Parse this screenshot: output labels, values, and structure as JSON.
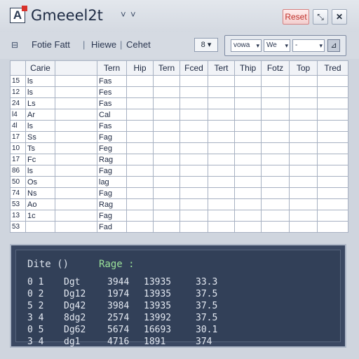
{
  "window": {
    "app_icon_glyph": "A",
    "title": "Gmeeel2t",
    "title_arrows": [
      "˅",
      "˅"
    ],
    "reset_label": "Reset",
    "minimize_glyph": "⤡",
    "close_glyph": "✕"
  },
  "toolbar": {
    "left_icon": "⊟",
    "items": [
      "Fotie Fatt",
      "Hiewe",
      "Cehet"
    ],
    "separator": "|",
    "select_value": "8",
    "group_fields": [
      "vowa",
      "We",
      "-"
    ],
    "end_icon": "⊿"
  },
  "table": {
    "columns": [
      "",
      "Carie",
      "",
      "Tern",
      "Hip",
      "Tern",
      "Fced",
      "Tert",
      "Thip",
      "Fotz",
      "Top",
      "Tred"
    ],
    "rows": [
      [
        "15",
        "ls",
        "",
        "Fas",
        "",
        "",
        "",
        "",
        "",
        "",
        "",
        ""
      ],
      [
        "12",
        "ls",
        "",
        "Fes",
        "",
        "",
        "",
        "",
        "",
        "",
        "",
        ""
      ],
      [
        "24",
        "Ls",
        "",
        "Fas",
        "",
        "",
        "",
        "",
        "",
        "",
        "",
        ""
      ],
      [
        "l4",
        "Ar",
        "",
        "Cal",
        "",
        "",
        "",
        "",
        "",
        "",
        "",
        ""
      ],
      [
        "4l",
        "ls",
        "",
        "Fas",
        "",
        "",
        "",
        "",
        "",
        "",
        "",
        ""
      ],
      [
        "17",
        "Ss",
        "",
        "Fag",
        "",
        "",
        "",
        "",
        "",
        "",
        "",
        ""
      ],
      [
        "10",
        "Ts",
        "",
        "Feg",
        "",
        "",
        "",
        "",
        "",
        "",
        "",
        ""
      ],
      [
        "17",
        "Fc",
        "",
        "Rag",
        "",
        "",
        "",
        "",
        "",
        "",
        "",
        ""
      ],
      [
        "86",
        "ls",
        "",
        "Fag",
        "",
        "",
        "",
        "",
        "",
        "",
        "",
        ""
      ],
      [
        "50",
        "Os",
        "",
        "lag",
        "",
        "",
        "",
        "",
        "",
        "",
        "",
        ""
      ],
      [
        "74",
        "Ns",
        "",
        "Fag",
        "",
        "",
        "",
        "",
        "",
        "",
        "",
        ""
      ],
      [
        "53",
        "Ao",
        "",
        "Rag",
        "",
        "",
        "",
        "",
        "",
        "",
        "",
        ""
      ],
      [
        "13",
        "1c",
        "",
        "Fag",
        "",
        "",
        "",
        "",
        "",
        "",
        "",
        ""
      ],
      [
        "53",
        "",
        "",
        "Fad",
        "",
        "",
        "",
        "",
        "",
        "",
        "",
        ""
      ]
    ]
  },
  "panel": {
    "title_left": "Dite ()",
    "title_right": "Rage :",
    "title_left_color": "#d9e0ea",
    "title_right_color": "#9be29a",
    "rows": [
      [
        "0 1",
        "Dgt",
        "3944",
        "13935",
        "33.3"
      ],
      [
        "0 2",
        "Dg12",
        "1974",
        "13935",
        "37.5"
      ],
      [
        "5 2",
        "Dg42",
        "3984",
        "13935",
        "37.5"
      ],
      [
        "3 4",
        "8dg2",
        "2574",
        "13992",
        "37.5"
      ],
      [
        "0 5",
        "Dg62",
        "5674",
        "16693",
        "30.1"
      ],
      [
        "3 4",
        "dg1",
        "4716",
        "1891",
        "374"
      ]
    ]
  }
}
